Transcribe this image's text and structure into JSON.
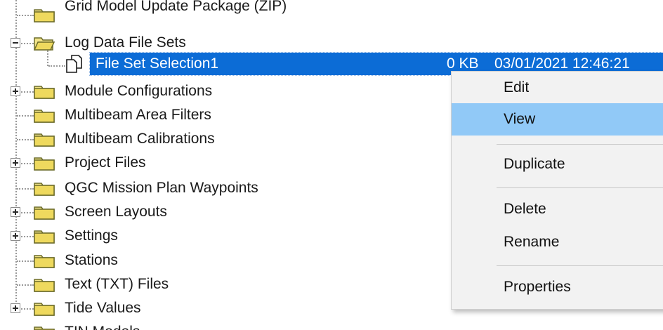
{
  "tree": {
    "items": [
      {
        "label": "Grid Model Update Package (ZIP)",
        "expander": "none"
      },
      {
        "label": "Log Data File Sets",
        "expander": "minus"
      },
      {
        "label": "File Set Selection1",
        "size": "0 KB",
        "date": "03/01/2021 12:46:21",
        "selected": true
      },
      {
        "label": "Module Configurations",
        "expander": "plus"
      },
      {
        "label": "Multibeam Area Filters",
        "expander": "none"
      },
      {
        "label": "Multibeam Calibrations",
        "expander": "none"
      },
      {
        "label": "Project Files",
        "expander": "plus"
      },
      {
        "label": "QGC Mission Plan Waypoints",
        "expander": "none"
      },
      {
        "label": "Screen Layouts",
        "expander": "plus"
      },
      {
        "label": "Settings",
        "expander": "plus"
      },
      {
        "label": "Stations",
        "expander": "none"
      },
      {
        "label": "Text (TXT) Files",
        "expander": "none"
      },
      {
        "label": "Tide Values",
        "expander": "plus"
      },
      {
        "label": "TIN Models",
        "expander": "none"
      }
    ]
  },
  "context_menu": {
    "items": [
      {
        "label": "Edit",
        "highlighted": false
      },
      {
        "label": "View",
        "highlighted": true
      },
      {
        "label": "Duplicate",
        "highlighted": false
      },
      {
        "label": "Delete",
        "highlighted": false
      },
      {
        "label": "Rename",
        "highlighted": false
      },
      {
        "label": "Properties",
        "highlighted": false
      }
    ]
  },
  "colors": {
    "selection": "#0c6cd6",
    "menu_highlight": "#91c9f7",
    "menu_background": "#f2f2f2",
    "folder_fill": "#f3e58a",
    "folder_outline": "#6b6b2a"
  }
}
